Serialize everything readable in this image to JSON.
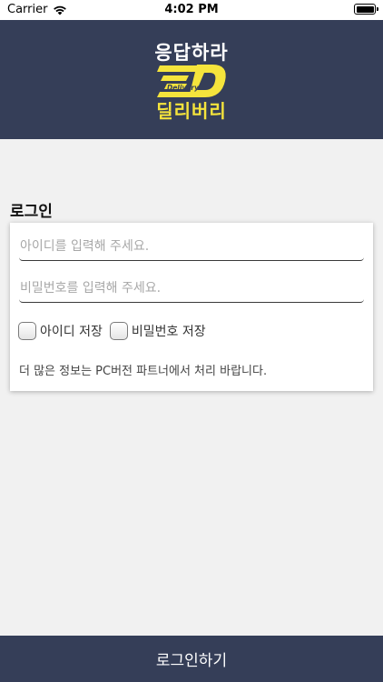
{
  "status_bar": {
    "carrier": "Carrier",
    "time": "4:02 PM"
  },
  "header": {
    "logo_top": "응답하라",
    "logo_mark_text": "Delivery",
    "logo_mark_letter": "D",
    "logo_bottom": "딜리버리",
    "bg_color": "#353e58",
    "accent_color": "#f5e43c"
  },
  "login": {
    "title": "로그인",
    "id_placeholder": "아이디를 입력해 주세요.",
    "pw_placeholder": "비밀번호를 입력해 주세요.",
    "save_id_label": "아이디 저장",
    "save_pw_label": "비밀번호 저장",
    "info": "더 많은 정보는 PC버전 파트너에서 처리 바랍니다.",
    "button_label": "로그인하기"
  },
  "icons": {
    "signal": "wifi-icon",
    "battery": "battery-icon",
    "logo": "delivery-logo-icon"
  }
}
